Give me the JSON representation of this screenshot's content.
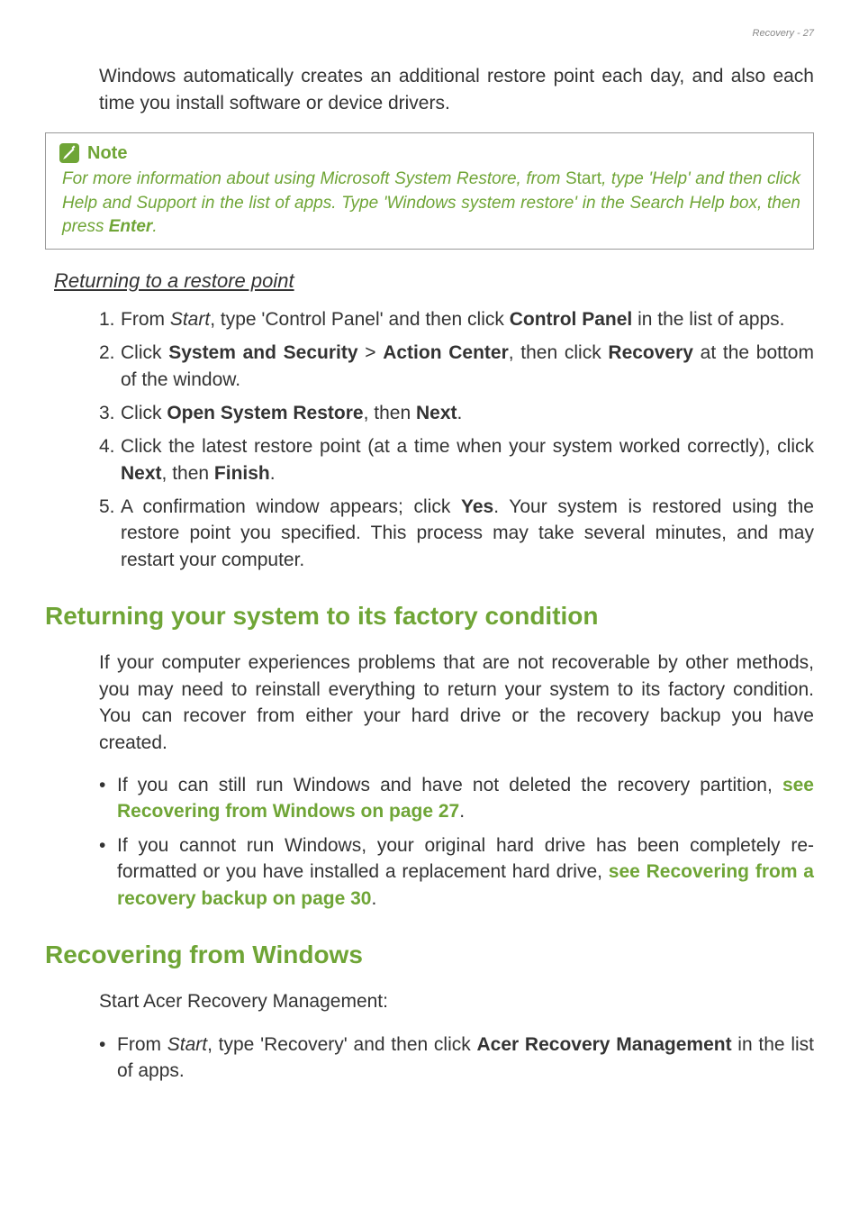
{
  "page_header": "Recovery - 27",
  "intro_para": "Windows automatically creates an additional restore point each day, and also each time you install software or device drivers.",
  "note": {
    "title": "Note",
    "body_prefix": "For more information about using Microsoft System Restore, from ",
    "body_start": "Start",
    "body_middle": ", type 'Help' and then click Help and Support in the list of apps. Type 'Windows system restore' in the Search Help box, then press ",
    "body_enter": "Enter",
    "body_suffix": "."
  },
  "sub_heading": "Returning to a restore point",
  "steps": [
    {
      "num": "1.",
      "html": "From <em>Start</em>, type 'Control Panel' and then click <strong>Control Panel</strong> in the list of apps."
    },
    {
      "num": "2.",
      "html": "Click <strong>System and Security</strong> > <strong>Action Center</strong>, then click <strong>Recovery</strong> at the bottom of the window."
    },
    {
      "num": "3.",
      "html": "Click <strong>Open System Restore</strong>, then <strong>Next</strong>."
    },
    {
      "num": "4.",
      "html": "Click the latest restore point (at a time when your system worked correctly), click <strong>Next</strong>, then <strong>Finish</strong>."
    },
    {
      "num": "5.",
      "html": "A confirmation window appears; click <strong>Yes</strong>. Your system is restored using the restore point you specified. This process may take several minutes, and may restart your computer."
    }
  ],
  "h2_factory": "Returning your system to its factory condition",
  "factory_para": "If your computer experiences problems that are not recoverable by other methods, you may need to reinstall everything to return your system to its factory condition. You can recover from either your hard drive or the recovery backup you have created.",
  "factory_bullets": [
    {
      "html": "If you can still run Windows and have not deleted the recovery partition, <span class='link'>see Recovering from Windows on page 27</span>."
    },
    {
      "html": "If you cannot run Windows, your original hard drive has been completely re-formatted or you have installed a replacement hard drive, <span class='link'>see Recovering from a recovery backup on page 30</span>."
    }
  ],
  "h2_recovering": "Recovering from Windows",
  "recovering_para": "Start Acer Recovery Management:",
  "recovering_bullets": [
    {
      "html": "From <em>Start</em>, type 'Recovery' and then click <strong>Acer Recovery Management</strong> in the list of apps."
    }
  ]
}
